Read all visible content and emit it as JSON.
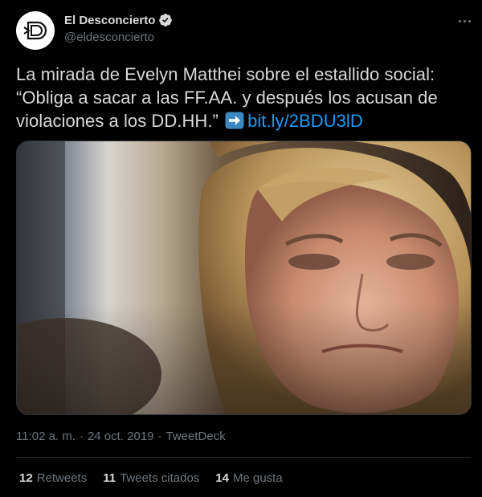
{
  "author": {
    "display_name": "El Desconcierto",
    "handle": "@eldesconcierto",
    "avatar_icon": "el-desconcierto-logo",
    "verified_icon": "verified-badge-icon"
  },
  "tweet": {
    "text": "La mirada de Evelyn Matthei sobre el estallido social: “Obliga a sacar a las FF.AA. y después los acusan de violaciones a los DD.HH.”",
    "emoji": "right-arrow-emoji",
    "link": "bit.ly/2BDU3lD"
  },
  "media": {
    "icon": "photo-of-woman-close-up"
  },
  "meta": {
    "time": "11:02 a. m.",
    "separator1": "·",
    "date": "24 oct. 2019",
    "separator2": "·",
    "source": "TweetDeck"
  },
  "stats": {
    "retweets_count": "12",
    "retweets_label": "Retweets",
    "quotes_count": "11",
    "quotes_label": "Tweets citados",
    "likes_count": "14",
    "likes_label": "Me gusta"
  },
  "colors": {
    "background": "#000000",
    "text": "#d9d9d9",
    "secondary_text": "#6e767d",
    "link": "#1d9bf0",
    "divider": "#2f3336"
  }
}
